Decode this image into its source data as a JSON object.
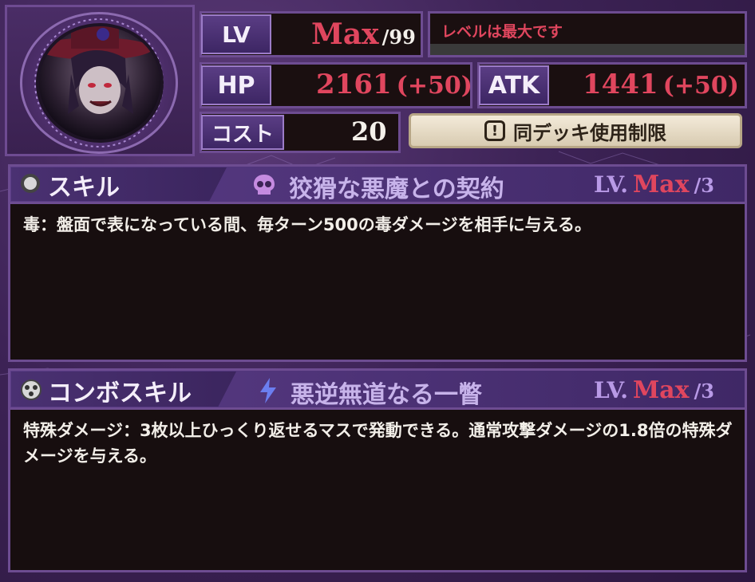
{
  "card": {
    "lv": {
      "label": "LV",
      "value": "Max",
      "max": "/99",
      "note": "レベルは最大です"
    },
    "hp": {
      "label": "HP",
      "value": "2161",
      "bonus": "(+50)"
    },
    "atk": {
      "label": "ATK",
      "value": "1441",
      "bonus": "(+50)"
    },
    "cost": {
      "label": "コスト",
      "value": "20"
    },
    "deck_limit_label": "同デッキ使用制限"
  },
  "skill": {
    "header": "スキル",
    "name": "狡猾な悪魔との契約",
    "lv_prefix": "LV.",
    "lv_value": "Max",
    "lv_max": "/3",
    "description": "毒：盤面で表になっている間、毎ターン500の毒ダメージを相手に与える。"
  },
  "combo": {
    "header": "コンボスキル",
    "name": "悪逆無道なる一瞥",
    "lv_prefix": "LV.",
    "lv_value": "Max",
    "lv_max": "/3",
    "description": "特殊ダメージ：3枚以上ひっくり返せるマスで発動できる。通常攻撃ダメージの1.8倍の特殊ダメージを与える。"
  },
  "colors": {
    "accent_red": "#e0465e",
    "frame_purple": "#6d4c91",
    "skill_lv_purple": "#b89ae6"
  },
  "icons": {
    "skill": "circle-dot-icon",
    "skill_type": "skull-icon",
    "combo": "combo-circles-icon",
    "combo_type": "lightning-icon",
    "deck_limit": "exclamation-icon"
  }
}
